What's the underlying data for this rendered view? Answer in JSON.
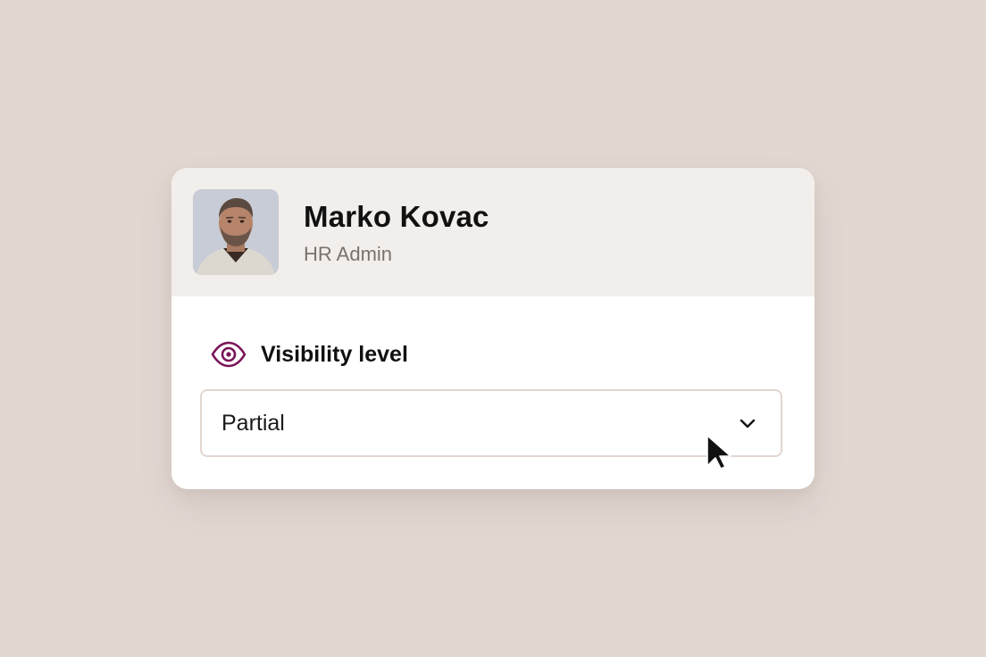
{
  "profile": {
    "name": "Marko Kovac",
    "role": "HR Admin",
    "avatar_icon": "person-photo"
  },
  "visibility": {
    "label": "Visibility level",
    "icon": "eye-icon",
    "selected_value": "Partial",
    "dropdown_icon": "chevron-down-icon"
  },
  "colors": {
    "background": "#e2d8d2",
    "header_background": "#f2eeeb",
    "accent": "#7a1457",
    "role_text": "#7a726e"
  }
}
